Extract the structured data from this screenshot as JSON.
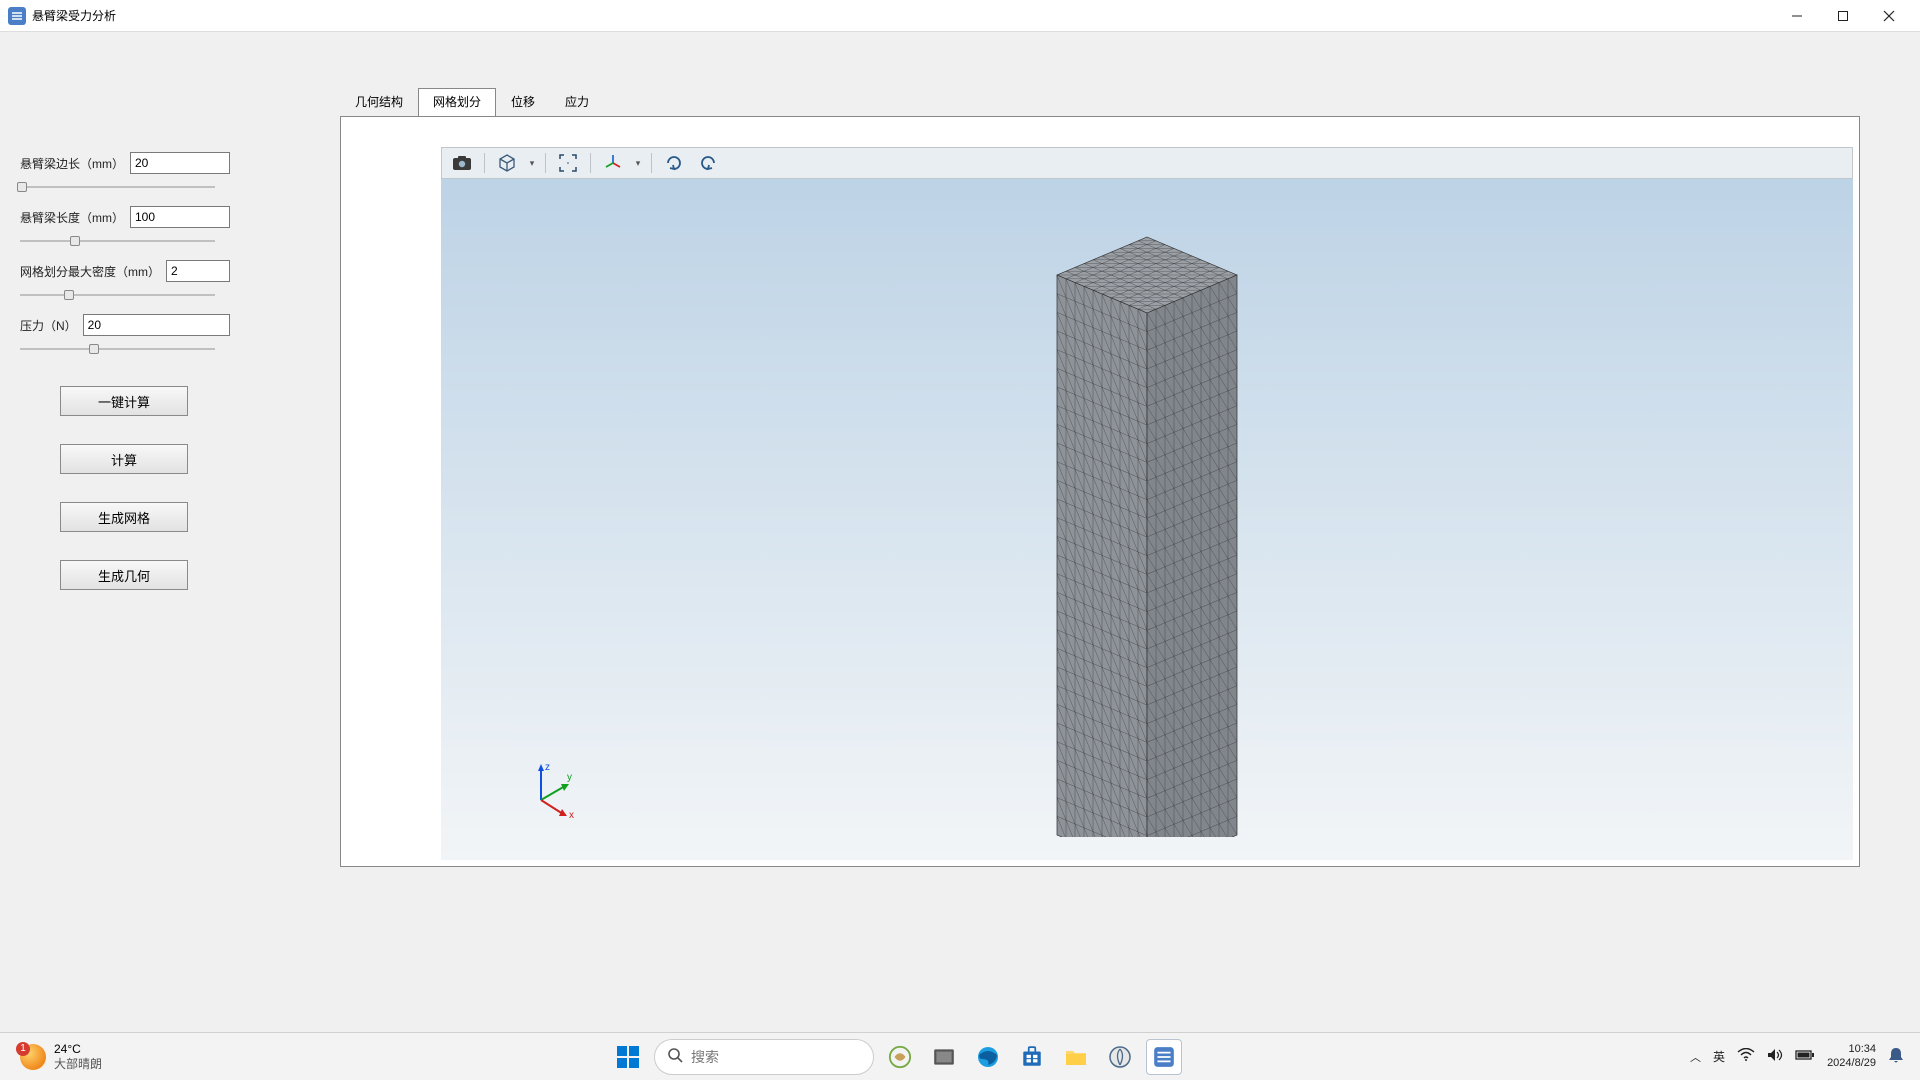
{
  "window": {
    "title": "悬臂梁受力分析"
  },
  "params": {
    "edge_length": {
      "label": "悬臂梁边长（mm）",
      "value": "20",
      "slider_pct": 1
    },
    "length": {
      "label": "悬臂梁长度（mm）",
      "value": "100",
      "slider_pct": 28
    },
    "mesh_density": {
      "label": "网格划分最大密度（mm）",
      "value": "2",
      "slider_pct": 25
    },
    "pressure": {
      "label": "压力（N）",
      "value": "20",
      "slider_pct": 38
    }
  },
  "actions": {
    "one_click_calc": "一键计算",
    "calc": "计算",
    "gen_mesh": "生成网格",
    "gen_geom": "生成几何"
  },
  "tabs": {
    "geometry": "几何结构",
    "mesh": "网格划分",
    "displacement": "位移",
    "stress": "应力",
    "active": "mesh"
  },
  "triad": {
    "x": "x",
    "y": "y",
    "z": "z"
  },
  "viewport_tools": {
    "screenshot": "screenshot-icon",
    "view_cube": "view-cube-icon",
    "fit_view": "fit-view-icon",
    "axes_toggle": "axes-toggle-icon",
    "rotate_cw": "rotate-cw-icon",
    "rotate_ccw": "rotate-ccw-icon"
  },
  "taskbar": {
    "weather_temp": "24°C",
    "weather_desc": "大部晴朗",
    "search_placeholder": "搜索",
    "ime": "英",
    "time": "10:34",
    "date": "2024/8/29"
  }
}
